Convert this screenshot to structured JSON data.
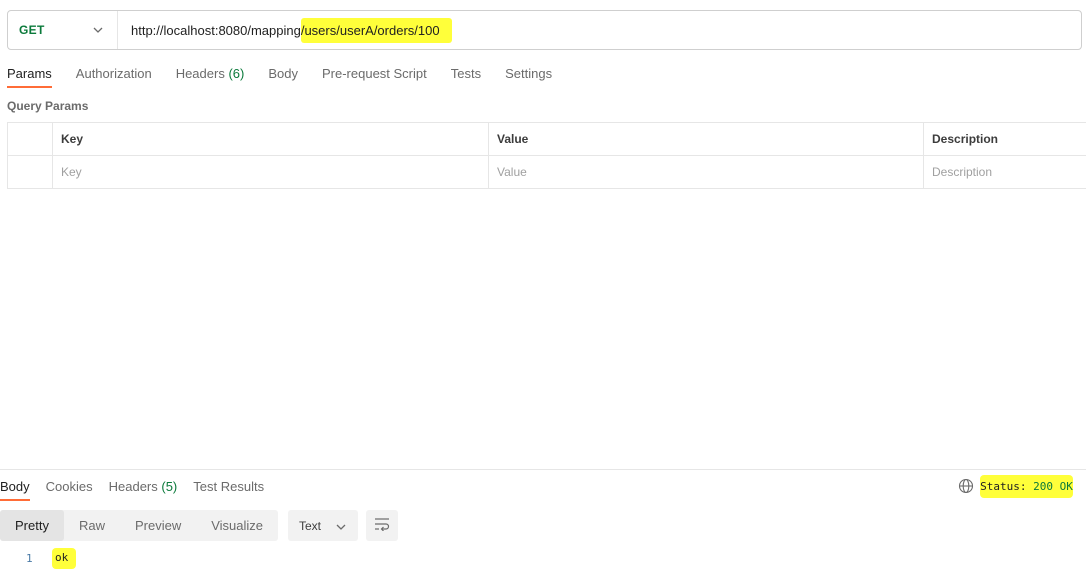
{
  "request": {
    "method": "GET",
    "url_prefix": "http://localhost:8080/mapping",
    "url_highlighted": "/users/userA/orders/100"
  },
  "request_tabs": [
    {
      "label": "Params",
      "active": true
    },
    {
      "label": "Authorization"
    },
    {
      "label": "Headers",
      "count": "(6)"
    },
    {
      "label": "Body"
    },
    {
      "label": "Pre-request Script"
    },
    {
      "label": "Tests"
    },
    {
      "label": "Settings"
    }
  ],
  "query_params": {
    "title": "Query Params",
    "headers": [
      "Key",
      "Value",
      "Description"
    ],
    "placeholders": [
      "Key",
      "Value",
      "Description"
    ]
  },
  "response_tabs": [
    {
      "label": "Body",
      "active": true
    },
    {
      "label": "Cookies"
    },
    {
      "label": "Headers",
      "count": "(5)"
    },
    {
      "label": "Test Results"
    }
  ],
  "status": {
    "prefix": "Status:",
    "value": "200 OK"
  },
  "view_modes": [
    "Pretty",
    "Raw",
    "Preview",
    "Visualize"
  ],
  "format": "Text",
  "response_body": [
    {
      "line": "1",
      "text": "ok"
    }
  ],
  "colors": {
    "accent": "#ff6c37",
    "highlight": "#ffff3a",
    "success": "#0b7a3b"
  }
}
